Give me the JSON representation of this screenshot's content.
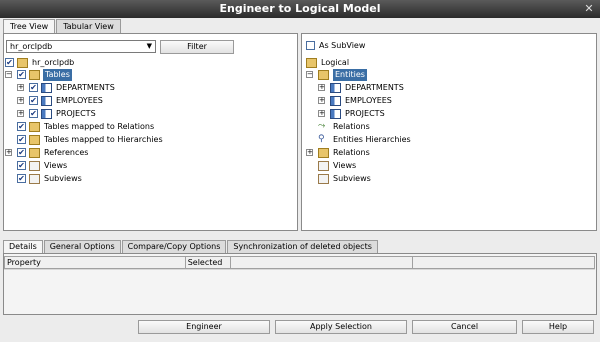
{
  "window": {
    "title": "Engineer to Logical Model",
    "close": "✕"
  },
  "tabs": [
    "Tree View",
    "Tabular View"
  ],
  "left": {
    "schema_select": "hr_orclpdb",
    "filter_label": "Filter",
    "tree": {
      "root": "hr_orclpdb",
      "tables": "Tables",
      "table_items": [
        "DEPARTMENTS",
        "EMPLOYEES",
        "PROJECTS"
      ],
      "mapped_relations": "Tables mapped to Relations",
      "mapped_hierarchies": "Tables mapped to Hierarchies",
      "references": "References",
      "views": "Views",
      "subviews": "Subviews"
    }
  },
  "right": {
    "as_subview": "As SubView",
    "tree": {
      "root": "Logical",
      "entities": "Entities",
      "entity_items": [
        "DEPARTMENTS",
        "EMPLOYEES",
        "PROJECTS"
      ],
      "relations": "Relations",
      "entities_hierarchies": "Entities Hierarchies",
      "relations2": "Relations",
      "views": "Views",
      "subviews": "Subviews"
    }
  },
  "bottom_tabs": [
    "Details",
    "General Options",
    "Compare/Copy Options",
    "Synchronization of deleted objects"
  ],
  "grid": {
    "col_property": "Property",
    "col_selected": "Selected"
  },
  "buttons": {
    "engineer": "Engineer",
    "apply": "Apply Selection",
    "cancel": "Cancel",
    "help": "Help"
  },
  "icons": {
    "check": "✔",
    "expand": "+",
    "collapse": "−",
    "arrow": "▼"
  }
}
